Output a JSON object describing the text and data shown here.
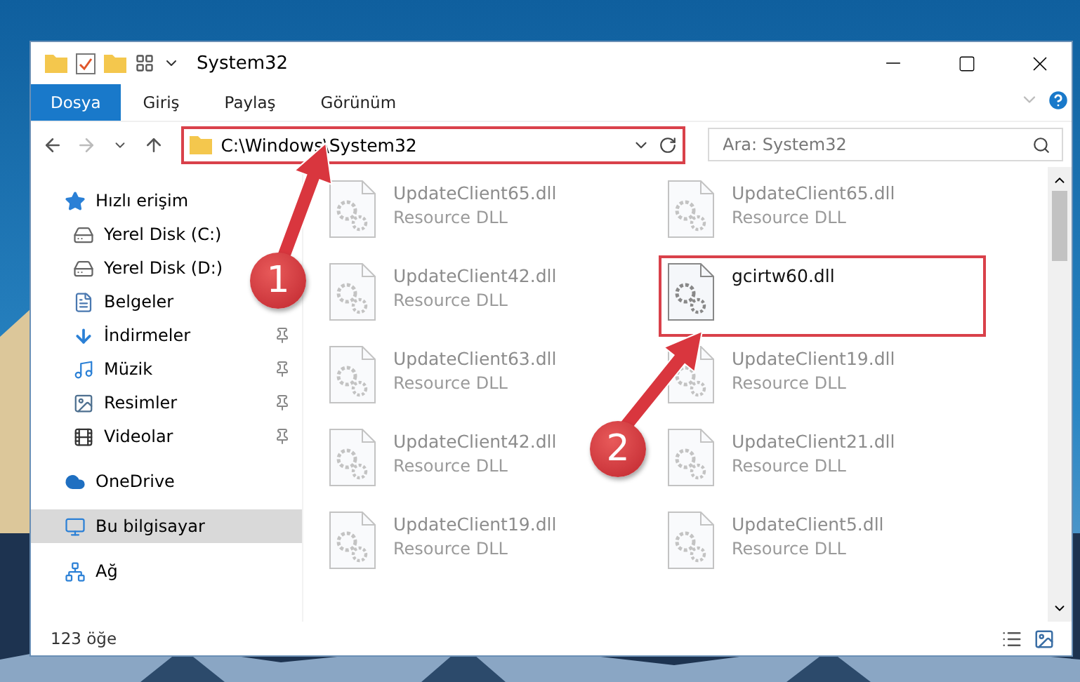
{
  "window": {
    "title": "System32"
  },
  "ribbon_tabs": [
    {
      "label": "Dosya",
      "kind": "file"
    },
    {
      "label": "Giriş",
      "kind": "tab"
    },
    {
      "label": "Paylaş",
      "kind": "tab"
    },
    {
      "label": "Görünüm",
      "kind": "tab"
    }
  ],
  "address_bar": {
    "path": "C:\\Windows\\System32",
    "highlighted": true
  },
  "search": {
    "placeholder": "Ara: System32"
  },
  "sidebar": {
    "items": [
      {
        "label": "Hızlı erişim",
        "kind": "quick",
        "selected": false,
        "children": [
          {
            "label": "Yerel Disk (C:)",
            "kind": "drive-c",
            "pinned": false,
            "selected": false
          },
          {
            "label": "Yerel Disk (D:)",
            "kind": "drive",
            "pinned": false,
            "selected": false
          },
          {
            "label": "Belgeler",
            "kind": "documents",
            "pinned": false,
            "selected": false
          },
          {
            "label": "İndirmeler",
            "kind": "downloads",
            "pinned": true,
            "selected": false
          },
          {
            "label": "Müzik",
            "kind": "music",
            "pinned": true,
            "selected": false
          },
          {
            "label": "Resimler",
            "kind": "pictures",
            "pinned": true,
            "selected": false
          },
          {
            "label": "Videolar",
            "kind": "videos",
            "pinned": true,
            "selected": false
          }
        ]
      },
      {
        "label": "OneDrive",
        "kind": "cloud",
        "selected": false
      },
      {
        "label": "Bu bilgisayar",
        "kind": "computer",
        "selected": true
      },
      {
        "label": "Ağ",
        "kind": "network",
        "selected": false
      }
    ]
  },
  "files": [
    {
      "name": "UpdateClient65.dll",
      "type": "Resource DLL",
      "faded": true,
      "highlighted": false
    },
    {
      "name": "UpdateClient65.dll",
      "type": "Resource DLL",
      "faded": true,
      "highlighted": false
    },
    {
      "name": "UpdateClient42.dll",
      "type": "Resource DLL",
      "faded": true,
      "highlighted": false
    },
    {
      "name": "gcirtw60.dll",
      "faded": false,
      "highlighted": true
    },
    {
      "name": "UpdateClient63.dll",
      "type": "Resource DLL",
      "faded": true,
      "highlighted": false
    },
    {
      "name": "UpdateClient19.dll",
      "type": "Resource DLL",
      "faded": true,
      "highlighted": false
    },
    {
      "name": "UpdateClient42.dll",
      "type": "Resource DLL",
      "faded": true,
      "highlighted": false
    },
    {
      "name": "UpdateClient21.dll",
      "type": "Resource DLL",
      "faded": true,
      "highlighted": false
    },
    {
      "name": "UpdateClient19.dll",
      "type": "Resource DLL",
      "faded": true,
      "highlighted": false
    },
    {
      "name": "UpdateClient5.dll",
      "type": "Resource DLL",
      "faded": true,
      "highlighted": false
    }
  ],
  "status_bar": {
    "item_count": "123 öğe"
  },
  "callouts": [
    {
      "number": "1"
    },
    {
      "number": "2"
    }
  ]
}
